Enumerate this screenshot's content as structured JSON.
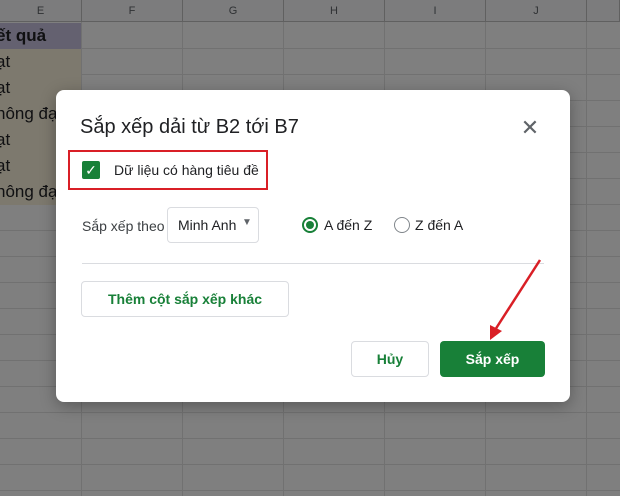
{
  "sheet": {
    "columns": [
      "E",
      "F",
      "G",
      "H",
      "I",
      "J"
    ],
    "cells": [
      "ết quả",
      "ạt",
      "ạt",
      "hông đạ",
      "ạt",
      "ạt",
      "hông đạ"
    ]
  },
  "dialog": {
    "title": "Sắp xếp dải từ B2 tới B7",
    "header_row_checkbox": {
      "label": "Dữ liệu có hàng tiêu đề",
      "checked": true
    },
    "sort_by_label": "Sắp xếp theo",
    "sort_column": {
      "value": "Minh Anh",
      "icon": "caret-down-icon"
    },
    "order_options": [
      {
        "label": "A đến Z",
        "selected": true
      },
      {
        "label": "Z đến A",
        "selected": false
      }
    ],
    "add_sort_column_label": "Thêm cột sắp xếp khác",
    "cancel_label": "Hủy",
    "sort_label": "Sắp xếp",
    "close_icon": "close-icon"
  },
  "colors": {
    "accent": "#188038",
    "highlight": "#d91f26",
    "header_fill": "#c9c3e1",
    "data_fill": "#fbf3dc"
  }
}
